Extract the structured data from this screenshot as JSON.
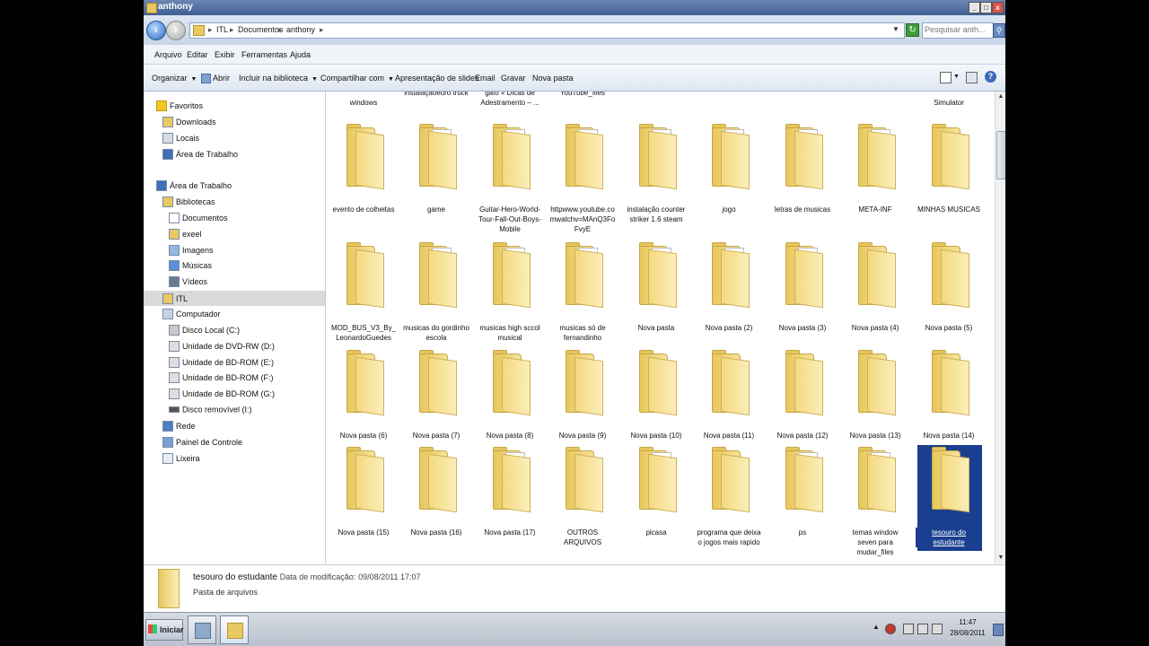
{
  "window": {
    "title": "anthony"
  },
  "address": {
    "crumbs": [
      "ITL",
      "Documentos",
      "anthony"
    ],
    "separator": "▸",
    "search_placeholder": "Pesquisar anth..."
  },
  "menubar": [
    "Arquivo",
    "Editar",
    "Exibir",
    "Ferramentas",
    "Ajuda"
  ],
  "toolbar": {
    "organizar": "Organizar",
    "abrir": "Abrir",
    "incluir": "Incluir na biblioteca",
    "compartilhar": "Compartilhar com",
    "apresentacao": "Apresentação de slides",
    "email": "Email",
    "gravar": "Gravar",
    "nova_pasta": "Nova pasta"
  },
  "nav": {
    "favoritos": "Favoritos",
    "downloads": "Downloads",
    "locais": "Locais",
    "area_trabalho_fav": "Área de Trabalho",
    "area_trabalho": "Área de Trabalho",
    "bibliotecas": "Bibliotecas",
    "documentos": "Documentos",
    "exeel": "exeel",
    "imagens": "Imagens",
    "musicas": "Músicas",
    "videos": "Vídeos",
    "itl": "ITL",
    "computador": "Computador",
    "disco_c": "Disco Local (C:)",
    "dvd_d": "Unidade de DVD-RW (D:)",
    "bd_e": "Unidade de BD-ROM (E:)",
    "bd_f": "Unidade de BD-ROM (F:)",
    "bd_g": "Unidade de BD-ROM (G:)",
    "disco_i": "Disco removível (I:)",
    "rede": "Rede",
    "painel": "Painel de Controle",
    "lixeira": "Lixeira"
  },
  "partial_row": [
    "windows",
    "instalaçãoeuro truck",
    "truques para seu gato « Dicas de Adestramento – ...",
    "placa de video - YouTube_files",
    "",
    "",
    "",
    "",
    "Simulator"
  ],
  "items": [
    "evento de colheitas",
    "game",
    "Guitar-Hero-World-Tour-Fall-Out-Boys-Mobile",
    "httpwww.youtube.comwatchv=MAnQ3FoFvyE",
    "instalação counter striker 1.6 steam",
    "jogo",
    "letras de musicas",
    "META-INF",
    "MINHAS MUSICAS",
    "MOD_BUS_V3_By_LeonardoGuedes",
    "musicas do gordinho escola",
    "musicas high sccol musical",
    "musicas só de fernandinho",
    "Nova pasta",
    "Nova pasta (2)",
    "Nova pasta (3)",
    "Nova pasta (4)",
    "Nova pasta (5)",
    "Nova pasta (6)",
    "Nova pasta (7)",
    "Nova pasta (8)",
    "Nova pasta (9)",
    "Nova pasta (10)",
    "Nova pasta (11)",
    "Nova pasta (12)",
    "Nova pasta (13)",
    "Nova pasta (14)",
    "Nova pasta (15)",
    "Nova pasta (16)",
    "Nova pasta (17)",
    "OUTROS ARQUIVOS",
    "picasa",
    "programa que deixa o jogos mais rapido",
    "ps",
    "temas window seven para mudar_files",
    "tesouro do estudante"
  ],
  "details": {
    "name": "tesouro do estudante",
    "mod_label": "Data de modificação:",
    "mod_date": "09/08/2011 17:07",
    "type": "Pasta de arquivos"
  },
  "taskbar": {
    "start": "Iniciar",
    "time": "11:47",
    "date": "28/08/2011"
  },
  "colors": {
    "selection": "#1a3f8f",
    "folder": "#f0d37a",
    "titlebar": "#4f6ea3"
  }
}
